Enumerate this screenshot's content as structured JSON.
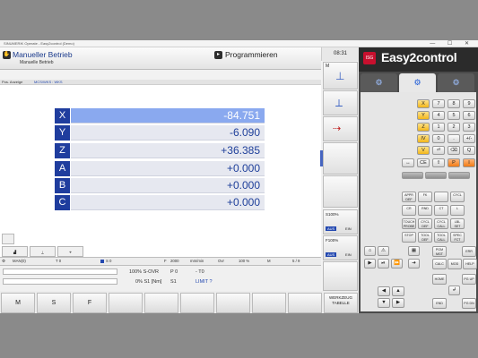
{
  "window": {
    "title": "SINUMERIK Operate - Easy2control (Demo)",
    "controls": "— ☐ ✕"
  },
  "header": {
    "mode_title": "Manueller Betrieb",
    "mode_subtitle": "Manuelle Betrieb",
    "program_button": "Programmieren",
    "clock": "08:31"
  },
  "position_line": {
    "label": "Pos. Anzeige",
    "coord": "MCS/WKS : WKS"
  },
  "axes": [
    {
      "name": "X",
      "value": "-84.751"
    },
    {
      "name": "Y",
      "value": "-6.090"
    },
    {
      "name": "Z",
      "value": "+36.385"
    },
    {
      "name": "A",
      "value": "+0.000"
    },
    {
      "name": "B",
      "value": "+0.000"
    },
    {
      "name": "C",
      "value": "+0.000"
    }
  ],
  "status_bar": {
    "channel": "MAN(0)",
    "tool": "T   0",
    "spindle": "S   0",
    "feed_label": "F",
    "feed": "2000",
    "feed_unit": "mm/min",
    "override_label": "Ovr",
    "override": "100 %",
    "m_label": "M",
    "m_value": "5 / 9"
  },
  "override": {
    "s_ovr": "100% S-OVR",
    "p0": "P 0",
    "t0": "- T0",
    "s1": "0% S1 [Nm]",
    "s1b": "S1",
    "limit": "LIMIT ?"
  },
  "softkeys_bottom": [
    "M",
    "S",
    "F"
  ],
  "right_keys": {
    "m_label": "M",
    "s100": "S100%",
    "s100_off": "AUS",
    "s100_on": "EIN",
    "f100": "F100%",
    "f100_off": "AUS",
    "f100_on": "EIN",
    "tool_table_1": "WERKZEUG",
    "tool_table_2": "TABELLE"
  },
  "panel": {
    "brand": "Easy2control",
    "brand_mark": "ISG",
    "tabs": [
      "⚙",
      "⚙",
      "⚙"
    ],
    "numpad": [
      [
        "X",
        "7",
        "8",
        "9"
      ],
      [
        "Y",
        "4",
        "5",
        "6"
      ],
      [
        "Z",
        "1",
        "2",
        "3"
      ],
      [
        "IV",
        "0",
        ".",
        "+/-"
      ],
      [
        "V",
        "⏎",
        "⌫",
        "Q"
      ],
      [
        "↔",
        "CE",
        "⇧",
        "P",
        "I"
      ]
    ],
    "func_keys": [
      [
        "APPR DEF",
        "FK",
        "",
        "CYCL"
      ],
      [
        "CR",
        "RND",
        "CT",
        "L"
      ],
      [
        "TOUCH PROBE",
        "CYCL DEF",
        "CYCL CALL",
        "LBL SET"
      ],
      [
        "STOP",
        "TOOL DEF",
        "TOOL CALL",
        "SPEC FCT"
      ]
    ],
    "lower_keys": [
      "PGM MGT",
      "ERR",
      "CALC",
      "MOD",
      "HELP",
      "HOME",
      "PG UP",
      "END",
      "PG DN"
    ]
  },
  "colors": {
    "axis_letter": "#1f3d9e",
    "axis_active": "#8aa9ef",
    "brand_red": "#c8102e",
    "key_yellow": "#f2b619",
    "key_orange": "#f07a14"
  }
}
